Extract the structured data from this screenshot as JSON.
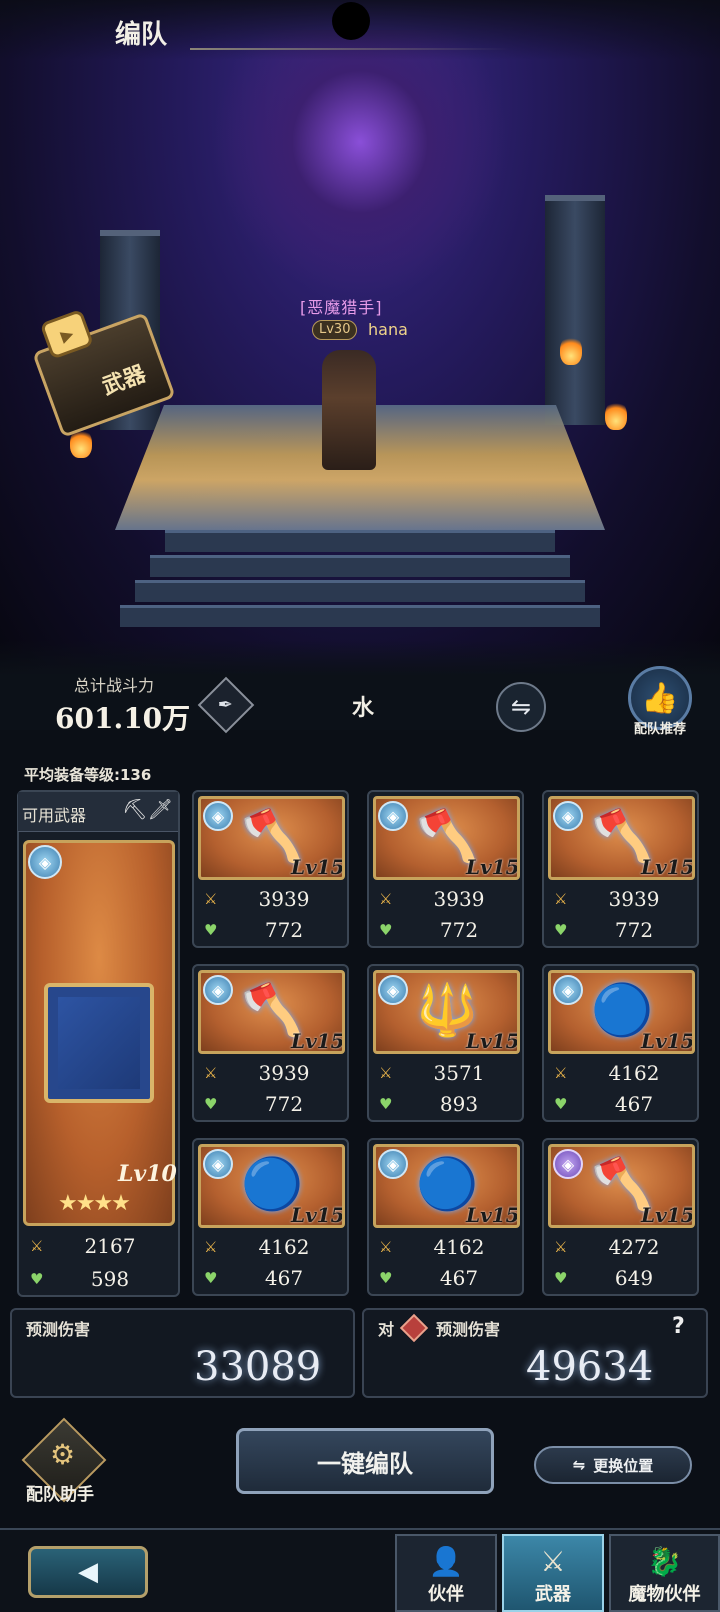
{
  "header": {
    "title": "编队"
  },
  "character": {
    "class": "[恶魔猎手]",
    "level": "Lv30",
    "name": "hana"
  },
  "weapon_badge": {
    "label": "武器"
  },
  "summary": {
    "power_label": "总计战斗力",
    "power_value": "601.10万",
    "element": "水",
    "recommend_label": "配队推荐",
    "avg_level": "平均装备等级:136"
  },
  "available_label": "可用武器",
  "main_weapon": {
    "level": "Lv10",
    "stars": "★★★★",
    "attack": "2167",
    "hp": "598"
  },
  "weapons": [
    {
      "level": "Lv15",
      "attack": "3939",
      "hp": "772",
      "icon": "axe-icon",
      "element": "water"
    },
    {
      "level": "Lv15",
      "attack": "3939",
      "hp": "772",
      "icon": "axe-icon",
      "element": "water"
    },
    {
      "level": "Lv15",
      "attack": "3939",
      "hp": "772",
      "icon": "axe-icon",
      "element": "water"
    },
    {
      "level": "Lv15",
      "attack": "3939",
      "hp": "772",
      "icon": "axe-icon",
      "element": "water"
    },
    {
      "level": "Lv15",
      "attack": "3571",
      "hp": "893",
      "icon": "spear-icon",
      "element": "water"
    },
    {
      "level": "Lv15",
      "attack": "4162",
      "hp": "467",
      "icon": "orb-icon",
      "element": "water"
    },
    {
      "level": "Lv15",
      "attack": "4162",
      "hp": "467",
      "icon": "orb-icon",
      "element": "water"
    },
    {
      "level": "Lv15",
      "attack": "4162",
      "hp": "467",
      "icon": "orb-icon",
      "element": "water"
    },
    {
      "level": "Lv15",
      "attack": "4272",
      "hp": "649",
      "icon": "axe-icon",
      "element": "dark"
    }
  ],
  "damage": {
    "predict_label": "预测伤害",
    "predict_value": "33089",
    "vs_prefix": "对",
    "vs_label": "预测伤害",
    "vs_value": "49634",
    "help": "?"
  },
  "actions": {
    "assist_label": "配队助手",
    "oneclick_label": "一键编队",
    "swap_label": "更换位置"
  },
  "nav": {
    "tabs": [
      {
        "label": "伙伴"
      },
      {
        "label": "武器"
      },
      {
        "label": "魔物伙伴"
      }
    ]
  },
  "colors": {
    "accent": "#c7a35c",
    "active_tab": "#3c87a8"
  }
}
